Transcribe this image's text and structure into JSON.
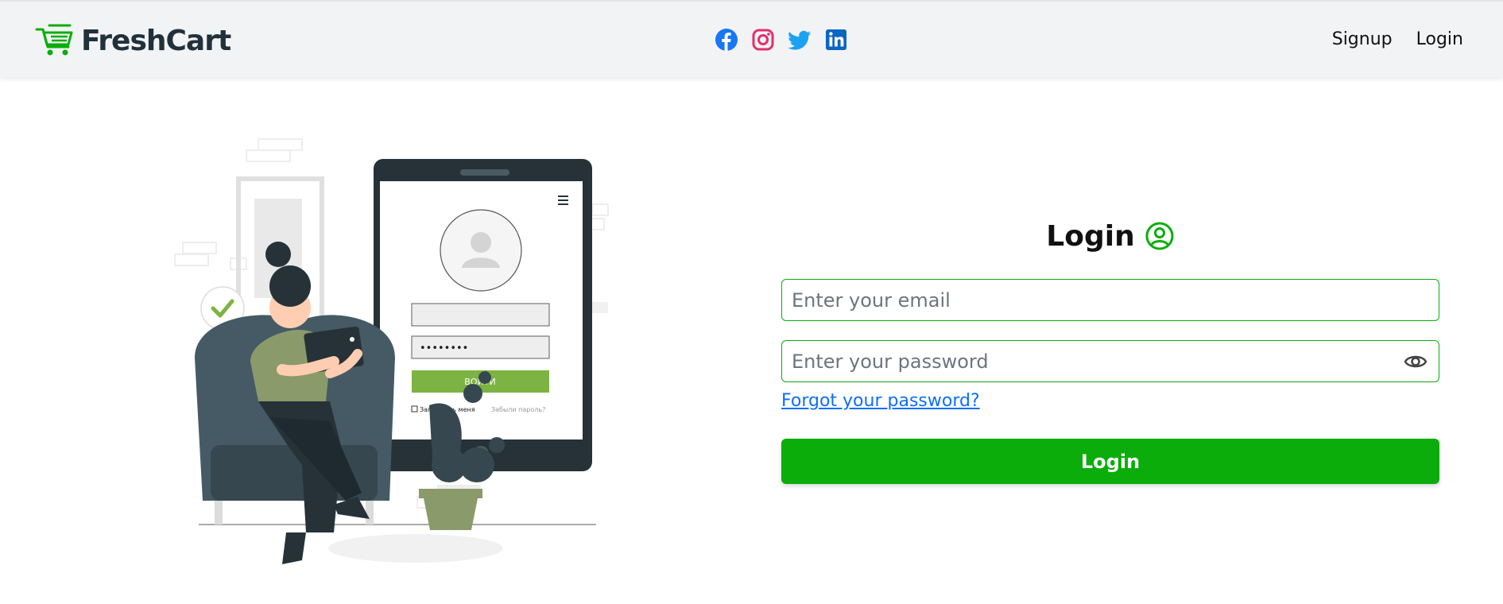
{
  "brand": {
    "name": "FreshCart",
    "icon": "cart-icon",
    "accent": "#0aad0a"
  },
  "social": [
    {
      "name": "facebook",
      "icon": "facebook-icon",
      "color": "#1877f2"
    },
    {
      "name": "instagram",
      "icon": "instagram-icon",
      "color": "#e1306c"
    },
    {
      "name": "twitter",
      "icon": "twitter-icon",
      "color": "#1da1f2"
    },
    {
      "name": "linkedin",
      "icon": "linkedin-icon",
      "color": "#0a66c2"
    }
  ],
  "nav": {
    "signup": "Signup",
    "login": "Login"
  },
  "illustration": {
    "button_text": "ВОЙТИ",
    "remember": "Запомнить меня",
    "forgot": "Забыли пароль?",
    "password_dots": "••••••••"
  },
  "login": {
    "title": "Login",
    "email_placeholder": "Enter your email",
    "password_placeholder": "Enter your password",
    "forgot": "Forgot your password?",
    "button": "Login",
    "accent": "#0aad0a"
  }
}
